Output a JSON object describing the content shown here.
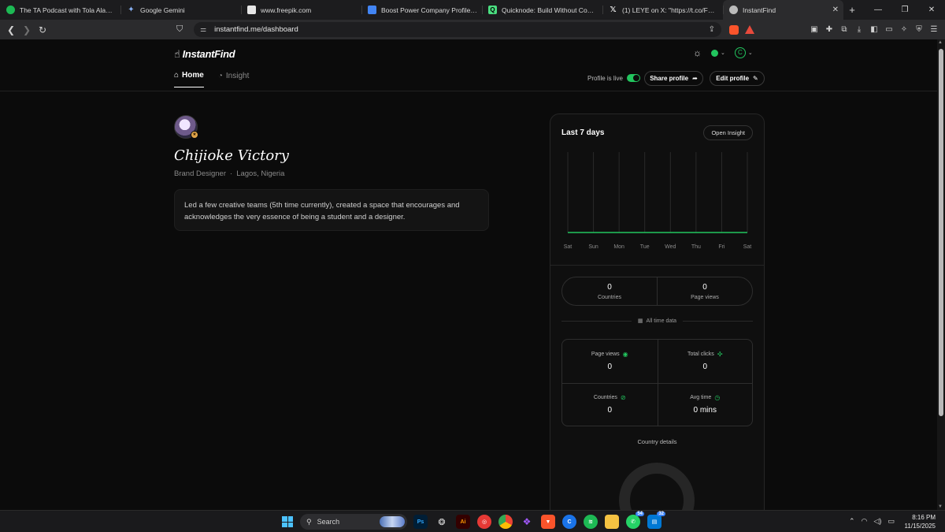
{
  "browser": {
    "tabs": [
      {
        "title": "The TA Podcast with Tola Alabi | Podc",
        "fav_color": "#1db954"
      },
      {
        "title": "Google Gemini",
        "fav_color": "#8ab4f8"
      },
      {
        "title": "www.freepik.com",
        "fav_color": "#e6e6e6"
      },
      {
        "title": "Boost Power Company Profile conte",
        "fav_color": "#4285f4"
      },
      {
        "title": "Quicknode: Build Without Comprom",
        "fav_color": "#4ade80"
      },
      {
        "title": "(1) LEYE on X: \"https://t.co/Fel2liZMB",
        "fav_color": "#ffffff"
      },
      {
        "title": "InstantFind",
        "fav_color": "#bbbbbb"
      }
    ],
    "url": "instantfind.me/dashboard",
    "brave_badge": "1"
  },
  "header": {
    "logo": "InstantFind",
    "tabs": [
      {
        "label": "Home",
        "active": true
      },
      {
        "label": "Insight",
        "active": false
      }
    ],
    "avatar_letter": "C",
    "live_label": "Profile is live",
    "share_label": "Share profile",
    "edit_label": "Edit profile"
  },
  "profile": {
    "name": "Chijioke Victory",
    "role": "Brand Designer",
    "location": "Lagos, Nigeria",
    "bio": "Led a few creative teams (5th time currently), created a space that encourages and acknowledges the very essence of being a student and a designer."
  },
  "insights": {
    "title": "Last 7 days",
    "open_label": "Open Insight",
    "chart_data": {
      "type": "line",
      "categories": [
        "Sat",
        "Sun",
        "Mon",
        "Tue",
        "Wed",
        "Thu",
        "Fri",
        "Sat"
      ],
      "series": [
        {
          "values": [
            0,
            0,
            0,
            0,
            0,
            0,
            0,
            0
          ],
          "color": "#22c55e"
        }
      ]
    },
    "summary": {
      "countries_value": "0",
      "countries_label": "Countries",
      "pageviews_value": "0",
      "pageviews_label": "Page views"
    },
    "all_time_label": "All time data",
    "stats": [
      {
        "label": "Page views",
        "value": "0",
        "icon": "eye-icon"
      },
      {
        "label": "Total clicks",
        "value": "0",
        "icon": "click-icon"
      },
      {
        "label": "Countries",
        "value": "0",
        "icon": "globe-icon"
      },
      {
        "label": "Avg time",
        "value": "0 mins",
        "icon": "clock-icon"
      }
    ],
    "country_details_label": "Country details"
  },
  "taskbar": {
    "search_label": "Search",
    "whatsapp_count": "54",
    "teams_count": "32",
    "time": "8:16 PM",
    "date": "11/15/2025"
  },
  "colors": {
    "accent": "#22c55e",
    "background": "#0b0b0b"
  }
}
